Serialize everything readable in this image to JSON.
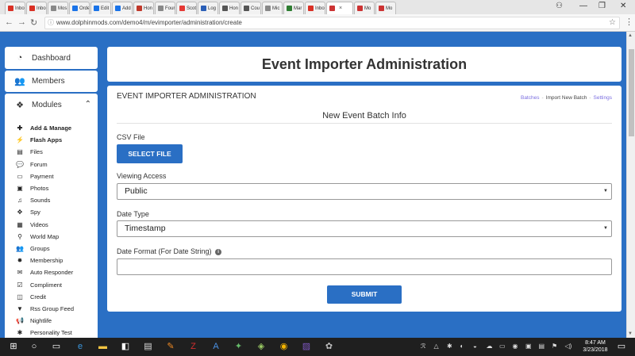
{
  "browser": {
    "tabs": [
      {
        "label": "Inbo",
        "fav": "#d93025"
      },
      {
        "label": "Inbo",
        "fav": "#d93025"
      },
      {
        "label": "Mos",
        "fav": "#888888"
      },
      {
        "label": "Orde",
        "fav": "#1a73e8"
      },
      {
        "label": "Edit",
        "fav": "#1a73e8"
      },
      {
        "label": "Add",
        "fav": "#1a73e8"
      },
      {
        "label": "Hon",
        "fav": "#c0392b"
      },
      {
        "label": "Four",
        "fav": "#888888"
      },
      {
        "label": "Scot",
        "fav": "#e53935"
      },
      {
        "label": "Log",
        "fav": "#2b5fb7"
      },
      {
        "label": "Hon",
        "fav": "#555555"
      },
      {
        "label": "Cou",
        "fav": "#555555"
      },
      {
        "label": "Mic",
        "fav": "#888888"
      },
      {
        "label": "Mar",
        "fav": "#2e7d32"
      },
      {
        "label": "Inbo",
        "fav": "#d93025"
      },
      {
        "label": "",
        "fav": "#cc3333",
        "active": true
      },
      {
        "label": "Mo",
        "fav": "#cc3333"
      },
      {
        "label": "Mo",
        "fav": "#cc3333"
      }
    ],
    "active_tab_close": "×",
    "window_controls": [
      "—",
      "❐",
      "✕"
    ],
    "profile_icon": "person-icon",
    "url": "www.dolphinmods.com/demo4/m/evimporter/administration/create",
    "nav": {
      "back": "←",
      "forward": "→",
      "reload": "↻"
    },
    "star": "☆",
    "menu": "⋮"
  },
  "sidebar": {
    "dashboard": {
      "label": "Dashboard",
      "icon": "dashboard-icon",
      "glyph": "◔"
    },
    "members": {
      "label": "Members",
      "icon": "users-icon",
      "glyph": "👥"
    },
    "modules": {
      "label": "Modules",
      "icon": "cubes-icon",
      "glyph": "❖",
      "chevron": "⌃"
    },
    "module_items": [
      {
        "label": "Add & Manage",
        "glyph": "✚",
        "icon": "plus-icon",
        "bold": true
      },
      {
        "label": "Flash Apps",
        "glyph": "⚡",
        "icon": "bolt-icon",
        "bold": true
      },
      {
        "label": "Files",
        "glyph": "▤",
        "icon": "files-icon"
      },
      {
        "label": "Forum",
        "glyph": "💬",
        "icon": "comments-icon"
      },
      {
        "label": "Payment",
        "glyph": "▭",
        "icon": "credit-card-icon"
      },
      {
        "label": "Photos",
        "glyph": "▣",
        "icon": "photo-icon"
      },
      {
        "label": "Sounds",
        "glyph": "♫",
        "icon": "music-icon"
      },
      {
        "label": "Spy",
        "glyph": "✥",
        "icon": "crosshair-icon"
      },
      {
        "label": "Videos",
        "glyph": "▦",
        "icon": "film-icon"
      },
      {
        "label": "World Map",
        "glyph": "⚲",
        "icon": "map-marker-icon"
      },
      {
        "label": "Groups",
        "glyph": "👥",
        "icon": "groups-icon"
      },
      {
        "label": "Membership",
        "glyph": "✸",
        "icon": "certificate-icon"
      },
      {
        "label": "Auto Responder",
        "glyph": "✉",
        "icon": "envelope-icon"
      },
      {
        "label": "Compliment",
        "glyph": "☑",
        "icon": "check-square-icon"
      },
      {
        "label": "Credit",
        "glyph": "◫",
        "icon": "credit-icon"
      },
      {
        "label": "Rss Group Feed",
        "glyph": "▼",
        "icon": "filter-icon"
      },
      {
        "label": "Nightlife",
        "glyph": "📢",
        "icon": "bullhorn-icon"
      },
      {
        "label": "Personality Test",
        "glyph": "✱",
        "icon": "asterisk-icon"
      }
    ]
  },
  "page": {
    "title": "Event Importer Administration",
    "section_title": "EVENT IMPORTER ADMINISTRATION",
    "crumbs": {
      "batches": "Batches",
      "current": "Import New Batch",
      "settings": "Settings",
      "sep": "-"
    },
    "subtitle": "New Event Batch Info",
    "csv_label": "CSV File",
    "select_file": "SELECT FILE",
    "viewing_label": "Viewing Access",
    "viewing_value": "Public",
    "date_type_label": "Date Type",
    "date_type_value": "Timestamp",
    "date_format_label": "Date Format (For Date String)",
    "submit": "SUBMIT",
    "select_arrow": "▼"
  },
  "taskbar": {
    "start": "⊞",
    "search": "○",
    "taskview": "▭",
    "apps": [
      {
        "icon": "edge-icon",
        "glyph": "e",
        "color": "#3a96dd"
      },
      {
        "icon": "file-explorer-icon",
        "glyph": "▬",
        "color": "#f4c542"
      },
      {
        "icon": "store-icon",
        "glyph": "◧",
        "color": "#ffffff"
      },
      {
        "icon": "notepad-icon",
        "glyph": "▤",
        "color": "#dddddd"
      },
      {
        "icon": "paint-icon",
        "glyph": "✎",
        "color": "#f08a24"
      },
      {
        "icon": "filezilla-icon",
        "glyph": "Z",
        "color": "#d32f2f"
      },
      {
        "icon": "translate-icon",
        "glyph": "A",
        "color": "#4a90e2"
      },
      {
        "icon": "puzzle-icon",
        "glyph": "✦",
        "color": "#66bb6a"
      },
      {
        "icon": "notepad-plus-icon",
        "glyph": "◈",
        "color": "#9ccc65"
      },
      {
        "icon": "chrome-icon",
        "glyph": "◉",
        "color": "#f4b400"
      },
      {
        "icon": "photo-viewer-icon",
        "glyph": "▨",
        "color": "#7e57c2"
      },
      {
        "icon": "tool-icon",
        "glyph": "✿",
        "color": "#bdbdbd"
      }
    ],
    "tray": [
      "ℛ",
      "△",
      "✱",
      "◐",
      "◒",
      "☁",
      "▭",
      "◉",
      "▣",
      "▤",
      "⚑",
      "◁)"
    ],
    "time": "8:47 AM",
    "date": "3/23/2018",
    "notifications": "▭"
  }
}
